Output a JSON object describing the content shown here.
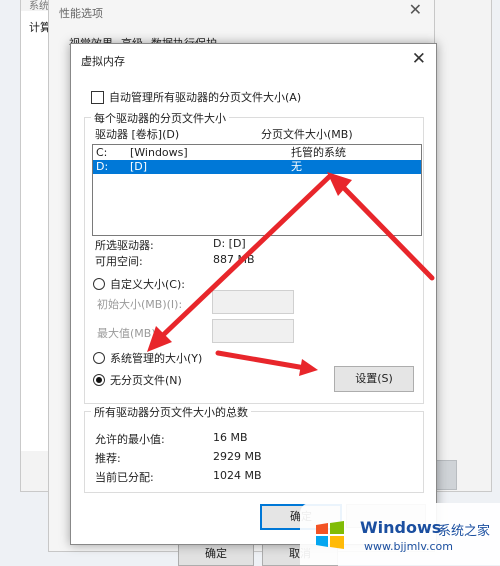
{
  "system_window": {
    "title": "系统",
    "tab": "计算"
  },
  "perf_window": {
    "title": "性能选项",
    "close_glyph": "✕",
    "tabs": [
      "视觉效果",
      "高级",
      "数据执行保护"
    ],
    "bottom_ok": "确定",
    "bottom_cancel": "取消"
  },
  "dialog": {
    "title": "虚拟内存",
    "close_glyph": "✕",
    "auto_manage_label": "自动管理所有驱动器的分页文件大小(A)",
    "group1_legend": "每个驱动器的分页文件大小",
    "col_drive": "驱动器 [卷标](D)",
    "col_size": "分页文件大小(MB)",
    "drives": [
      {
        "drive": "C:",
        "label": "[Windows]",
        "size": "托管的系统"
      },
      {
        "drive": "D:",
        "label": "[D]",
        "size": "无"
      }
    ],
    "selected_drive_label": "所选驱动器:",
    "selected_drive_value": "D:  [D]",
    "free_space_label": "可用空间:",
    "free_space_value": "887 MB",
    "custom_size_label": "自定义大小(C):",
    "initial_size_label": "初始大小(MB)(I):",
    "max_size_label": "最大值(MB)",
    "system_managed_label": "系统管理的大小(Y)",
    "no_paging_label": "无分页文件(N)",
    "set_button": "设置(S)",
    "group2_legend": "所有驱动器分页文件大小的总数",
    "min_allowed_label": "允许的最小值:",
    "min_allowed_value": "16 MB",
    "recommended_label": "推荐:",
    "recommended_value": "2929 MB",
    "current_label": "当前已分配:",
    "current_value": "1024 MB",
    "ok_button": "确定"
  },
  "watermark": {
    "brand": "Windows",
    "brand_cn": "系统之家",
    "url": "www.bjjmlv.com"
  },
  "colors": {
    "selection": "#0078d7",
    "arrow": "#e8262b",
    "brand": "#1b4fa0"
  }
}
